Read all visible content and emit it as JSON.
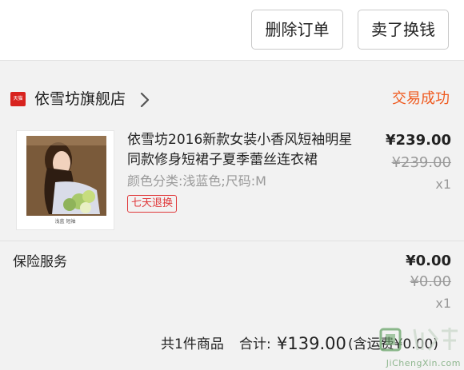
{
  "actions": {
    "delete_label": "删除订单",
    "sell_label": "卖了换钱"
  },
  "shop": {
    "badge": "天猫",
    "name": "依雪坊旗舰店",
    "status": "交易成功"
  },
  "product": {
    "title": "依雪坊2016新款女装小香风短袖明星同款修身短裙子夏季蕾丝连衣裙",
    "spec": "颜色分类:浅蓝色;尺码:M",
    "tag": "七天退换",
    "image_caption": "浅蓝 短袖",
    "price": "¥239.00",
    "original_price": "¥239.00",
    "quantity": "x1"
  },
  "insurance": {
    "label": "保险服务",
    "price": "¥0.00",
    "original_price": "¥0.00",
    "quantity": "x1"
  },
  "summary": {
    "count": "共1件商品",
    "total_label": "合计:",
    "total_value": "¥139.00",
    "freight_note": "(含运费¥0.00)"
  },
  "watermark": {
    "text": "JiChengXin.com"
  },
  "colors": {
    "accent": "#ef5a1f",
    "tag_red": "#e0383a",
    "tmall_red": "#d8231f"
  },
  "icons": {
    "shop": "tmall-icon",
    "chevron": "chevron-right-icon"
  }
}
